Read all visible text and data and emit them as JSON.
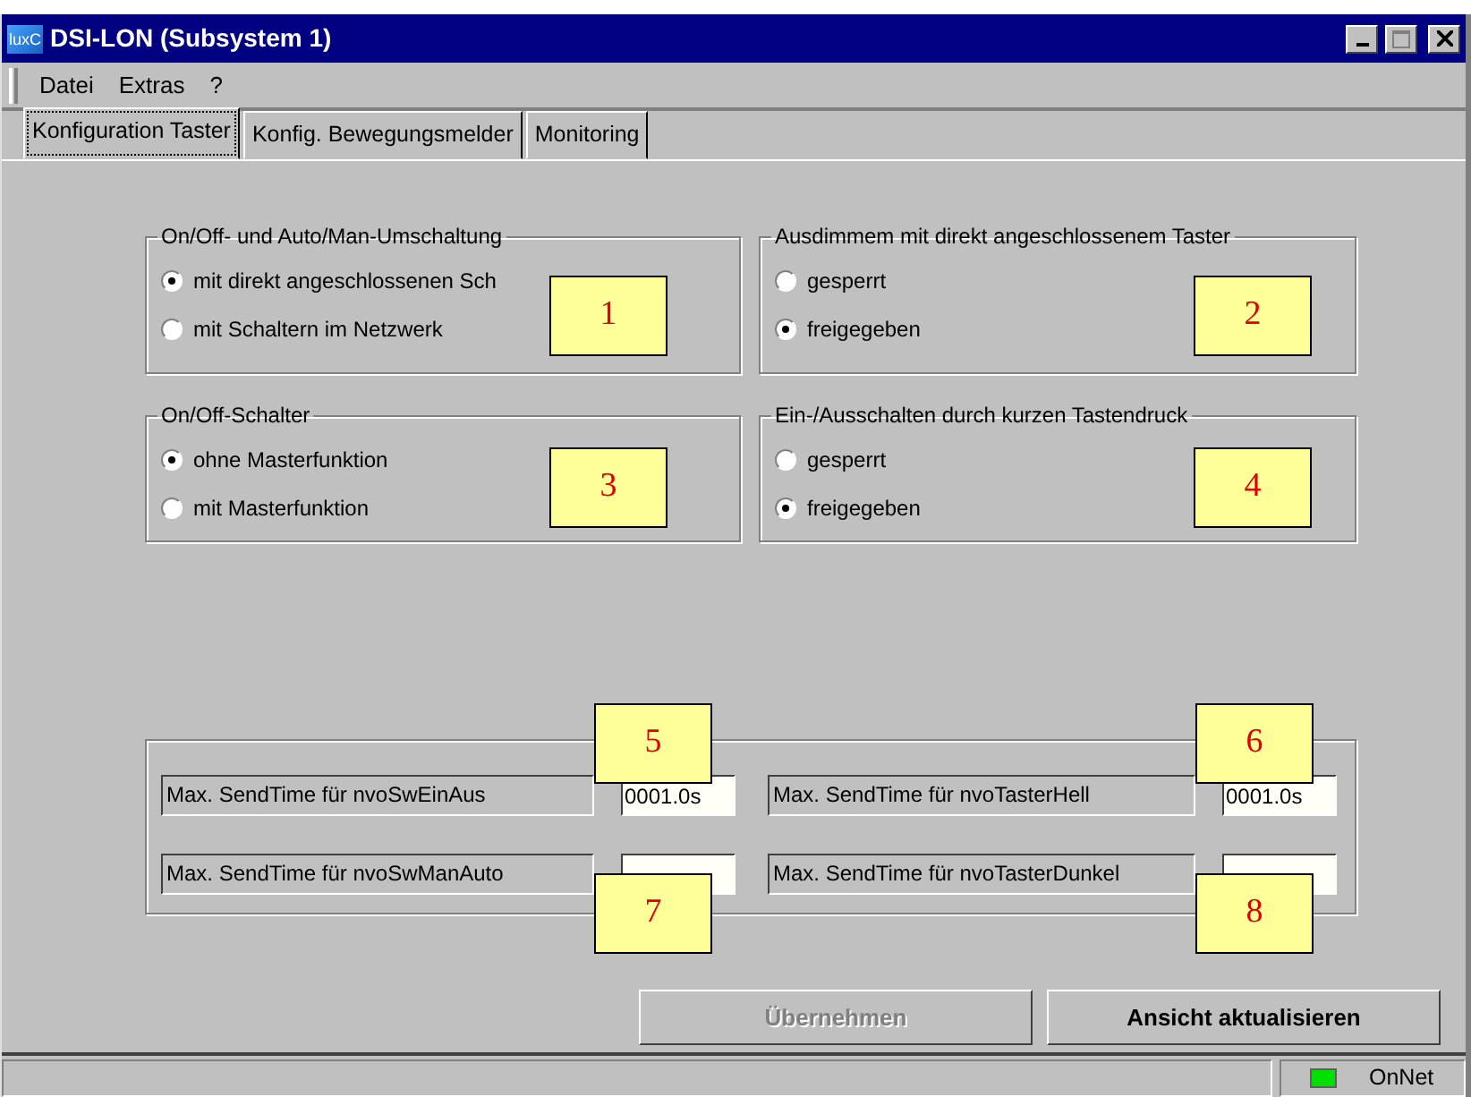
{
  "window": {
    "title": "DSI-LON (Subsystem 1)",
    "icon_text": "luxC"
  },
  "menu": [
    "Datei",
    "Extras",
    "?"
  ],
  "tabs": [
    {
      "label": "Konfiguration Taster",
      "selected": true
    },
    {
      "label": "Konfig. Bewegungsmelder",
      "selected": false
    },
    {
      "label": "Monitoring",
      "selected": false
    }
  ],
  "option_groups": [
    {
      "title": "On/Off- und Auto/Man-Umschaltung",
      "options": [
        {
          "label": "mit direkt angeschlossenen Sch",
          "selected": true
        },
        {
          "label": "mit Schaltern im Netzwerk",
          "selected": false
        }
      ]
    },
    {
      "title": "Ausdimmem mit direkt angeschlossenem Taster",
      "options": [
        {
          "label": "gesperrt",
          "selected": false
        },
        {
          "label": "freigegeben",
          "selected": true
        }
      ]
    },
    {
      "title": "On/Off-Schalter",
      "options": [
        {
          "label": "ohne Masterfunktion",
          "selected": true
        },
        {
          "label": "mit Masterfunktion",
          "selected": false
        }
      ]
    },
    {
      "title": "Ein-/Ausschalten durch kurzen Tastendruck",
      "options": [
        {
          "label": "gesperrt",
          "selected": false
        },
        {
          "label": "freigegeben",
          "selected": true
        }
      ]
    }
  ],
  "send_times": [
    {
      "label": "Max. SendTime für nvoSwEinAus",
      "value": "0001.0s"
    },
    {
      "label": "Max. SendTime für nvoTasterHell",
      "value": "0001.0s"
    },
    {
      "label": "Max. SendTime für nvoSwManAuto"
    },
    {
      "label": "Max. SendTime für nvoTasterDunkel"
    }
  ],
  "buttons": [
    {
      "label": "Übernehmen",
      "disabled": true
    },
    {
      "label": "Ansicht aktualisieren",
      "disabled": false
    }
  ],
  "status_bar": {
    "connection": "OnNet",
    "online": true
  },
  "callouts": [
    "1",
    "2",
    "3",
    "4",
    "5",
    "6",
    "7",
    "8"
  ]
}
